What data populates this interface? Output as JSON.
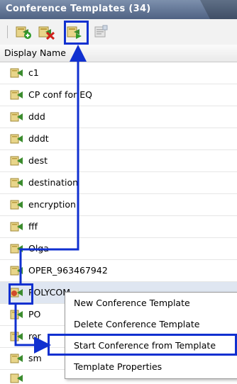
{
  "panel": {
    "title": "Conference Templates (34)"
  },
  "toolbar": {
    "buttons": [
      {
        "name": "add-template-icon"
      },
      {
        "name": "delete-template-icon"
      },
      {
        "name": "start-conference-icon"
      },
      {
        "name": "template-properties-icon"
      }
    ]
  },
  "table": {
    "header": "Display Name",
    "rows": [
      {
        "label": "c1",
        "icon": "template-icon"
      },
      {
        "label": "CP conf for EQ",
        "icon": "template-icon"
      },
      {
        "label": "ddd",
        "icon": "template-icon"
      },
      {
        "label": "dddt",
        "icon": "template-icon"
      },
      {
        "label": "dest",
        "icon": "template-icon"
      },
      {
        "label": "destination",
        "icon": "template-icon"
      },
      {
        "label": "encryption",
        "icon": "template-icon"
      },
      {
        "label": "fff",
        "icon": "template-icon"
      },
      {
        "label": "Olga",
        "icon": "template-icon"
      },
      {
        "label": "OPER_963467942",
        "icon": "template-icon"
      },
      {
        "label": "POLYCOM",
        "icon": "template-icon"
      },
      {
        "label": "PO",
        "icon": "template-icon"
      },
      {
        "label": "ror",
        "icon": "template-icon"
      },
      {
        "label": "sm",
        "icon": "template-icon"
      }
    ]
  },
  "context_menu": {
    "items": [
      "New Conference Template",
      "Delete Conference Template",
      "Start Conference from Template",
      "Template Properties"
    ]
  },
  "colors": {
    "highlight": "#1030d0",
    "title_bg": "#4f6283",
    "selected_row": "#dfe6f1"
  }
}
